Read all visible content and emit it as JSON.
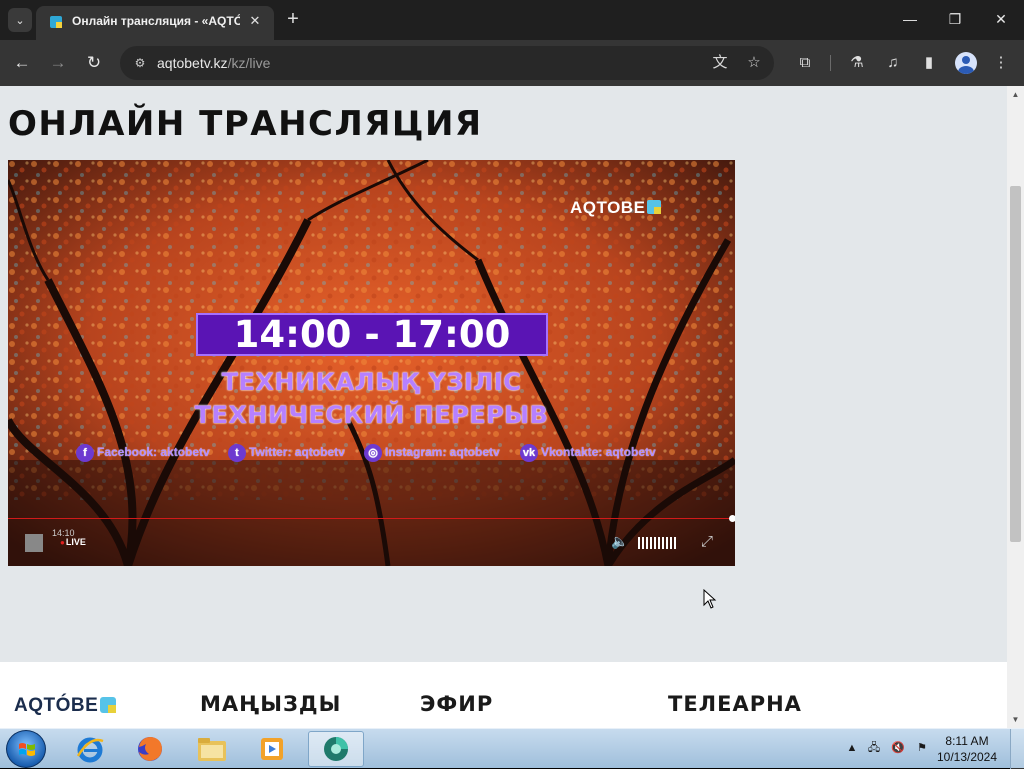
{
  "browser": {
    "tab_title": "Онлайн трансляция - «AQTÓBE»",
    "tab_close": "✕",
    "new_tab": "+",
    "url_domain": "aqtobetv.kz",
    "url_path": "/kz/live",
    "window_controls": {
      "minimize": "—",
      "maximize": "❐",
      "close": "✕"
    },
    "icons": [
      "tab-search-icon",
      "back-arrow-icon",
      "forward-arrow-icon",
      "reload-icon",
      "site-info-icon",
      "translate-icon",
      "bookmark-star-icon",
      "extensions-icon",
      "labs-flask-icon",
      "media-control-icon",
      "side-panel-icon",
      "profile-avatar-icon",
      "menu-kebab-icon"
    ]
  },
  "page": {
    "title": "ОНЛАЙН ТРАНСЛЯЦИЯ",
    "player": {
      "channel_logo": "AQTOBE",
      "time_range": "14:00 - 17:00",
      "break_kz": "ТЕХНИКАЛЫҚ ҮЗІЛІС",
      "break_ru": "ТЕХНИЧЕСКИЙ ПЕРЕРЫВ",
      "socials": [
        {
          "icon": "facebook-icon",
          "glyph": "f",
          "label": "Facebook: aktobetv"
        },
        {
          "icon": "twitter-icon",
          "glyph": "t",
          "label": "Twitter: aqtobetv"
        },
        {
          "icon": "instagram-icon",
          "glyph": "◎",
          "label": "Instagram: aqtobetv"
        },
        {
          "icon": "vk-icon",
          "glyph": "vk",
          "label": "Vkontakte: aqtobetv"
        }
      ],
      "current_time": "14:10",
      "live_label": "LIVE",
      "progress": 1.0,
      "accent_color": "#d21a1a"
    },
    "footer": {
      "logo": "AQTÓBE",
      "headings": [
        "МАҢЫЗДЫ",
        "ЭФИР",
        "ТЕЛЕАРНА"
      ]
    }
  },
  "taskbar": {
    "apps": [
      "internet-explorer-icon",
      "firefox-icon",
      "file-explorer-icon",
      "media-player-icon",
      "browser-app-icon"
    ],
    "clock_time": "8:11 AM",
    "clock_date": "10/13/2024"
  }
}
